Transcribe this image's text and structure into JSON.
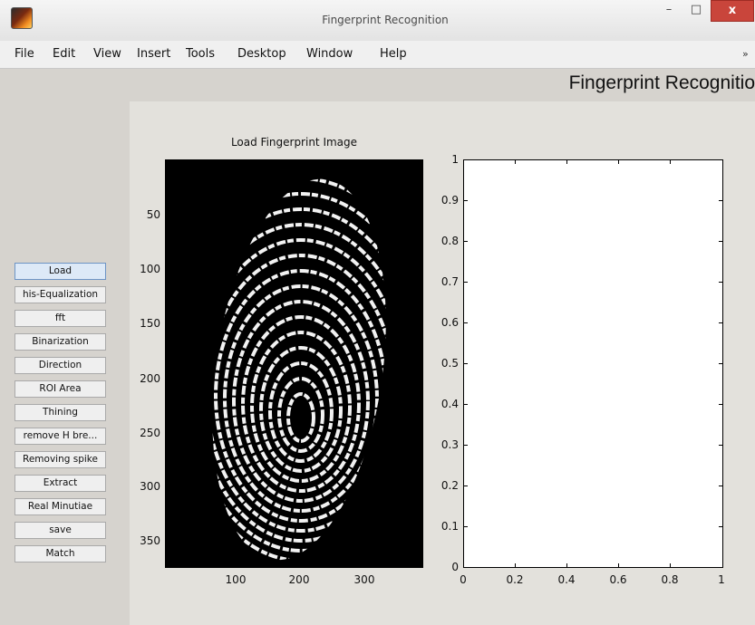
{
  "window": {
    "title": "Fingerprint Recognition",
    "controls": {
      "minimize": "–",
      "maximize": "□",
      "close": "x"
    }
  },
  "menu": [
    "File",
    "Edit",
    "View",
    "Insert",
    "Tools",
    "Desktop",
    "Window",
    "Help"
  ],
  "menu_overflow": "»",
  "app_title": "Fingerprint Recognitio",
  "buttons": [
    "Load",
    "his-Equalization",
    "fft",
    "Binarization",
    "Direction",
    "ROI Area",
    "Thining",
    "remove H bre...",
    "Removing spike",
    "Extract",
    "Real Minutiae",
    "save",
    "Match"
  ],
  "image_axes": {
    "title": "Load Fingerprint Image",
    "yticks": [
      "50",
      "100",
      "150",
      "200",
      "250",
      "300",
      "350"
    ],
    "xticks": [
      "100",
      "200",
      "300"
    ]
  },
  "empty_axes": {
    "yticks": [
      "1",
      "0.9",
      "0.8",
      "0.7",
      "0.6",
      "0.5",
      "0.4",
      "0.3",
      "0.2",
      "0.1",
      "0"
    ],
    "xticks": [
      "0",
      "0.2",
      "0.4",
      "0.6",
      "0.8",
      "1"
    ]
  },
  "colors": {
    "close_button": "#c9453b",
    "active_button": "#dde9f7",
    "panel": "#e3e1dc",
    "window": "#d6d3ce"
  }
}
